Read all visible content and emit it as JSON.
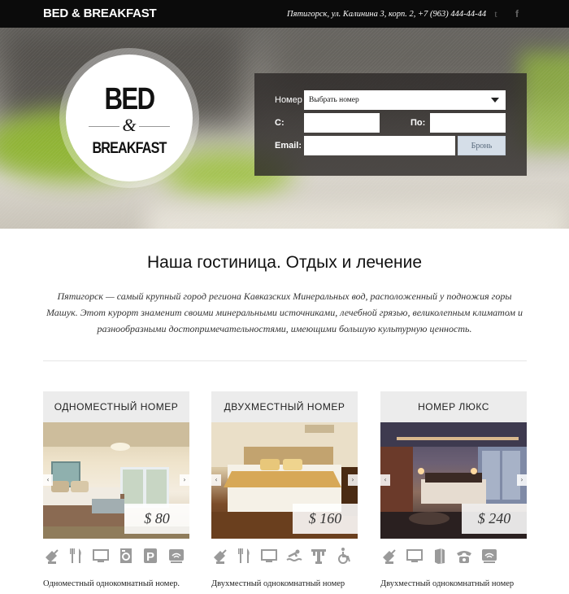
{
  "header": {
    "brand": "BED & BREAKFAST",
    "contact": "Пятигорск, ул. Калинина 3, корп. 2, +7 (963) 444-44-44",
    "social": [
      {
        "icon": "twitter-icon",
        "glyph": "t"
      },
      {
        "icon": "facebook-icon",
        "glyph": "f"
      }
    ]
  },
  "hero": {
    "logo": {
      "line1": "BED",
      "amp": "&",
      "line2": "BREAKFAST"
    },
    "form": {
      "room_label": "Номер",
      "room_select_value": "Выбрать номер",
      "from_label": "С:",
      "to_label": "По:",
      "email_label": "Email:",
      "submit_label": "Бронь"
    }
  },
  "about": {
    "title": "Наша гостиница. Отдых и лечение",
    "text": "Пятигорск — самый крупный город региона Кавказских Минеральных вод, расположенный у подножия горы Машук. Этот курорт знаменит своими минеральными источниками, лечебной грязью, великолепным климатом и разнообразными достопримечательностями, имеющими большую культурную ценность."
  },
  "rooms": [
    {
      "title": "ОДНОМЕСТНЫЙ НОМЕР",
      "price": "$ 80",
      "amenities": [
        "satellite-icon",
        "restaurant-icon",
        "tv-icon",
        "washer-icon",
        "parking-icon",
        "wifi-icon"
      ],
      "description": "Одноместный однокомнатный номер."
    },
    {
      "title": "ДВУХМЕСТНЫЙ НОМЕР",
      "price": "$ 160",
      "amenities": [
        "satellite-icon",
        "restaurant-icon",
        "tv-icon",
        "pool-icon",
        "gym-icon",
        "accessible-icon"
      ],
      "description": "Двухместный однокомнатный номер"
    },
    {
      "title": "НОМЕР ЛЮКС",
      "price": "$ 240",
      "amenities": [
        "satellite-icon",
        "tv-icon",
        "fridge-icon",
        "phone-icon",
        "wifi-icon"
      ],
      "description": "Двухместный однокомнатный номер"
    }
  ],
  "slider": {
    "prev": "‹",
    "next": "›"
  }
}
